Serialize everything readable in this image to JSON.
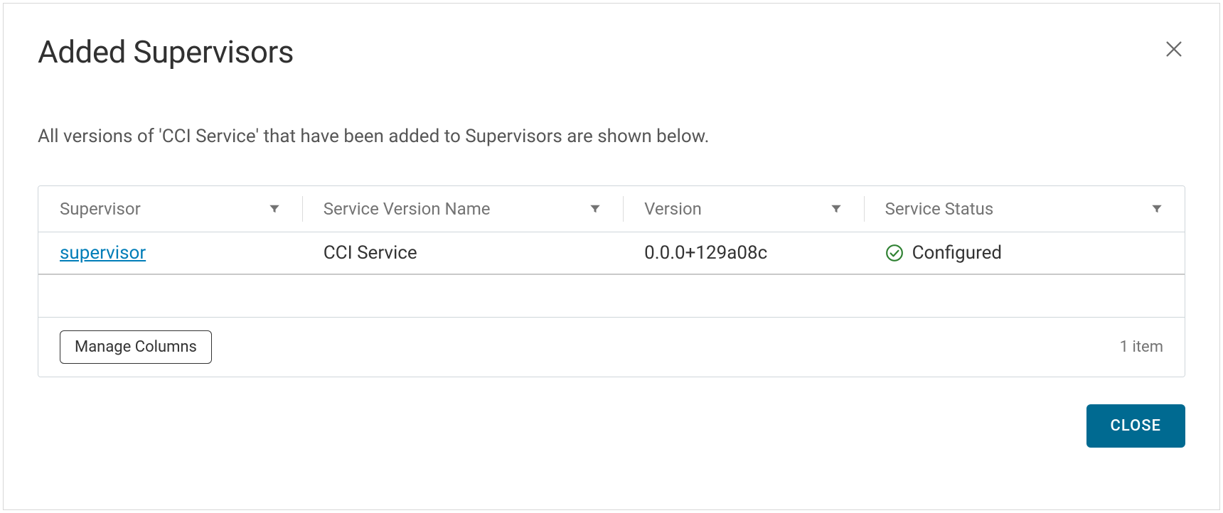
{
  "dialog": {
    "title": "Added Supervisors",
    "description": "All versions of 'CCI Service' that have been added to Supervisors are shown below."
  },
  "table": {
    "columns": {
      "supervisor": "Supervisor",
      "serviceVersionName": "Service Version Name",
      "version": "Version",
      "serviceStatus": "Service Status"
    },
    "rows": [
      {
        "supervisor": "supervisor",
        "serviceVersionName": "CCI Service",
        "version": "0.0.0+129a08c",
        "serviceStatus": "Configured"
      }
    ],
    "footer": {
      "manageColumns": "Manage Columns",
      "itemCount": "1 item"
    }
  },
  "actions": {
    "close": "CLOSE"
  }
}
